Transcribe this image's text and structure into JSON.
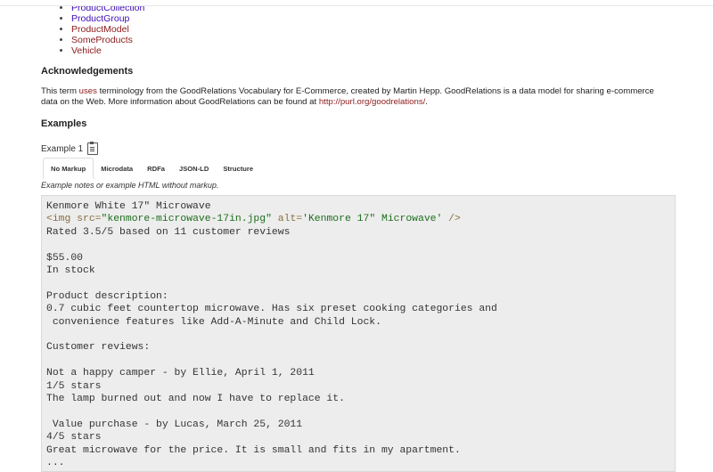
{
  "related_links": [
    {
      "label": "ProductCollection",
      "visited": false
    },
    {
      "label": "ProductGroup",
      "visited": false
    },
    {
      "label": "ProductModel",
      "visited": true
    },
    {
      "label": "SomeProducts",
      "visited": true
    },
    {
      "label": "Vehicle",
      "visited": true
    }
  ],
  "acknowledgements": {
    "heading": "Acknowledgements",
    "text_1": "This term ",
    "link_uses": "uses",
    "text_2": " terminology from the GoodRelations Vocabulary for E-Commerce, created by Martin Hepp. GoodRelations is a data model for sharing e-commerce data on the Web. More information about GoodRelations can be found at ",
    "link_url": "http://purl.org/goodrelations/",
    "text_3": "."
  },
  "examples": {
    "heading": "Examples",
    "example_label": "Example 1",
    "tabs": [
      "No Markup",
      "Microdata",
      "RDFa",
      "JSON-LD",
      "Structure"
    ],
    "active_tab": "No Markup",
    "note": "Example notes or example HTML without markup.",
    "code": {
      "line1": "Kenmore White 17\" Microwave",
      "img_tag_open": "<img src=",
      "img_src": "\"kenmore-microwave-17in.jpg\"",
      "img_alt_attr": " alt=",
      "img_alt": "'Kenmore 17\" Microwave'",
      "img_tag_close": " />",
      "line3": "Rated 3.5/5 based on 11 customer reviews",
      "line4": "",
      "line5": "$55.00",
      "line6": "In stock",
      "line7": "",
      "line8": "Product description:",
      "line9": "0.7 cubic feet countertop microwave. Has six preset cooking categories and",
      "line10": " convenience features like Add-A-Minute and Child Lock.",
      "line11": "",
      "line12": "Customer reviews:",
      "line13": "",
      "line14": "Not a happy camper - by Ellie, April 1, 2011",
      "line15": "1/5 stars",
      "line16": "The lamp burned out and now I have to replace it.",
      "line17": "",
      "line18": " Value purchase - by Lucas, March 25, 2011",
      "line19": "4/5 stars",
      "line20": "Great microwave for the price. It is small and fits in my apartment.",
      "line21": "..."
    }
  }
}
